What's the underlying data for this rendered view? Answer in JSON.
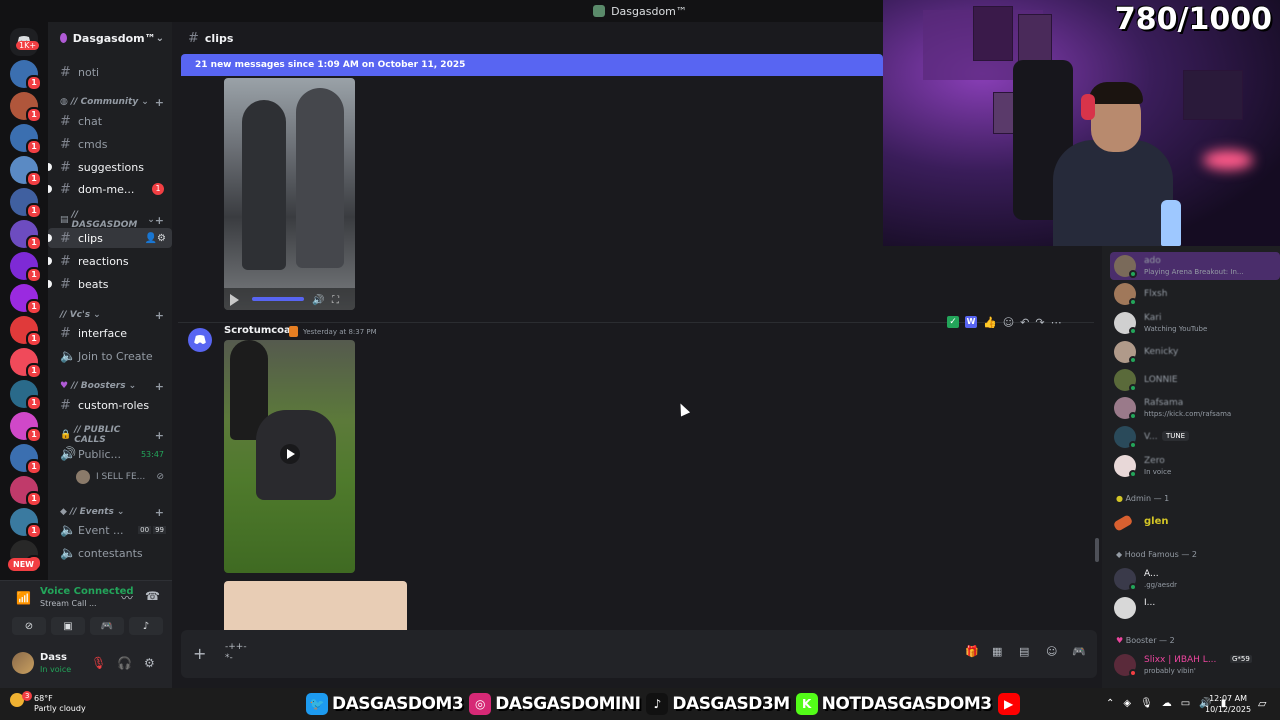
{
  "window": {
    "title": "Dasgasdom™"
  },
  "rail": {
    "home_badge": "1K+",
    "new_label": "NEW",
    "servers": [
      {
        "color": "#3b6fb0",
        "badge": "1"
      },
      {
        "color": "#b0563b",
        "badge": "1"
      },
      {
        "color": "#3b6fb0",
        "badge": "1"
      },
      {
        "color": "#5a8ac4",
        "badge": "1"
      },
      {
        "color": "#4060a0",
        "badge": "1"
      },
      {
        "color": "#6d4cc0",
        "badge": "1"
      },
      {
        "color": "#7e2ad6",
        "badge": "1"
      },
      {
        "color": "#9a2ae0",
        "badge": "1"
      },
      {
        "color": "#e03a3a",
        "badge": "1"
      },
      {
        "color": "#f04a5a",
        "badge": "1"
      },
      {
        "color": "#2a6a8a",
        "badge": "1"
      },
      {
        "color": "#d048c8",
        "badge": "1"
      },
      {
        "color": "#3b6fb0",
        "badge": "1"
      },
      {
        "color": "#c03a6a",
        "badge": "1"
      },
      {
        "color": "#3a7aa0",
        "badge": "1"
      },
      {
        "color": "#282828",
        "badge": "1"
      }
    ]
  },
  "guild": {
    "name": "Dasgasdom™"
  },
  "channels": {
    "noti": "noti",
    "cat_community": "// Community",
    "chat": "chat",
    "cmds": "cmds",
    "suggestions": "suggestions",
    "dom_me": "dom-me...",
    "dom_me_badge": "1",
    "cat_dasgasdom": "// DASGASDOM",
    "clips": "clips",
    "reactions": "reactions",
    "beats": "beats",
    "cat_vcs": "// Vc's",
    "interface": "interface",
    "join_to_create": "Join to Create",
    "cat_boosters": "// Boosters",
    "custom_roles": "custom-roles",
    "cat_public_calls": "// PUBLIC CALLS",
    "public": "Public...",
    "public_timer": "53:47",
    "public_member": "I SELL FE...",
    "cat_events": "// Events",
    "event": "Event ...",
    "event_counts": [
      "00",
      "99"
    ],
    "contestants": "contestants"
  },
  "voice": {
    "title": "Voice Connected",
    "sub": "Stream Call ..."
  },
  "user": {
    "name": "Dass",
    "status": "In voice"
  },
  "chat": {
    "channel": "clips",
    "new_messages": "21 new messages since 1:09 AM on October 11, 2025",
    "msg2_author": "Scrotumcoat",
    "msg2_time": "Yesterday at 8:37 PM",
    "composer_text": "-++-\n*-"
  },
  "members": {
    "list": [
      {
        "name": "ado",
        "activity": "Playing Arena Breakout: In...",
        "color": "#7a6a5a"
      },
      {
        "name": "Flxsh",
        "activity": "",
        "color": "#a0785a"
      },
      {
        "name": "Kari",
        "activity": "Watching YouTube",
        "color": "#d0d0d0"
      },
      {
        "name": "Kenicky",
        "activity": "",
        "color": "#b09a8a"
      },
      {
        "name": "LONNIE",
        "activity": "",
        "color": "#5a6a3a"
      },
      {
        "name": "Rafsama",
        "activity": "https://kick.com/rafsama",
        "color": "#9a7a8a"
      },
      {
        "name": "V...",
        "activity": "",
        "color": "#2a4a5a"
      },
      {
        "name": "Zero",
        "activity": "In voice",
        "color": "#e8d8d8"
      }
    ],
    "tune_label": "TUNE",
    "cat_admin": "Admin — 1",
    "admin_name": "glen",
    "cat_hood": "Hood Famous — 2",
    "hood": [
      {
        "name": "A...",
        "activity": ".gg/aesdr",
        "color": "#3a3a4a"
      },
      {
        "name": "I...",
        "activity": "",
        "color": "#d8d8d8"
      }
    ],
    "cat_booster": "Booster — 2",
    "booster_name": "Slixx | ИВАН L...",
    "booster_tag": "G*59",
    "booster_activity": "probably vibin'"
  },
  "stream": {
    "goal": "780/1000"
  },
  "taskbar": {
    "temp": "68°F",
    "weather": "Partly cloudy",
    "weather_badge": "3",
    "time": "12:07 AM",
    "date": "10/12/2025",
    "socials": [
      {
        "icon": "twitter-icon",
        "text": "DASGASDOM3",
        "color": "#1d9bf0"
      },
      {
        "icon": "instagram-icon",
        "text": "DASGASDOMINI",
        "color": "#d62976"
      },
      {
        "icon": "tiktok-icon",
        "text": "DASGASD3M",
        "color": "#111111"
      },
      {
        "icon": "kick-icon",
        "text": "NOTDASGASDOM3",
        "color": "#53fc18"
      },
      {
        "icon": "youtube-icon",
        "text": "",
        "color": "#ff0000"
      }
    ]
  }
}
